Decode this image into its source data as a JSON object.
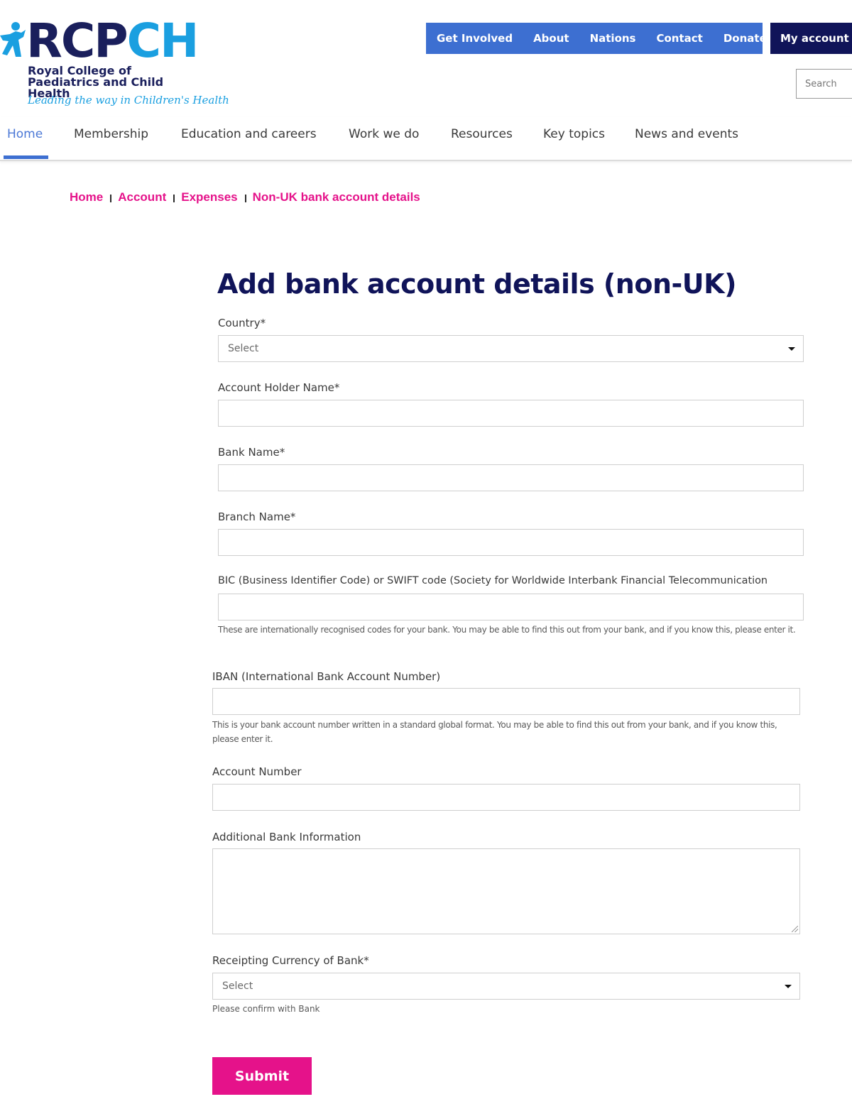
{
  "brand": {
    "name_part1": "RCP",
    "name_part2": "CH",
    "subtitle_line1": "Royal College of",
    "subtitle_line2": "Paediatrics and Child Health",
    "tagline": "Leading the way in Children's Health",
    "colors": {
      "navy": "#101459",
      "blue": "#3d6fd1",
      "pink": "#e5128a",
      "sky": "#1a9fe0"
    }
  },
  "utility_nav": [
    "Get Involved",
    "About",
    "Nations",
    "Contact",
    "Donate"
  ],
  "my_account": "My account",
  "search": {
    "placeholder": "Search"
  },
  "main_nav": {
    "items": [
      "Home",
      "Membership",
      "Education and careers",
      "Work we do",
      "Resources",
      "Key topics",
      "News and events"
    ],
    "active": "Home"
  },
  "breadcrumb": [
    "Home",
    "Account",
    "Expenses",
    "Non-UK bank account details"
  ],
  "form": {
    "title": "Add bank account details (non-UK)",
    "country": {
      "label": "Country*",
      "value": "Select"
    },
    "account_holder": {
      "label": "Account Holder Name*",
      "value": ""
    },
    "bank_name": {
      "label": "Bank Name*",
      "value": ""
    },
    "branch_name": {
      "label": "Branch Name*",
      "value": ""
    },
    "bic": {
      "label": "BIC (Business Identifier Code) or SWIFT code (Society for Worldwide Interbank Financial Telecommunication",
      "value": "",
      "hint": "These are internationally recognised codes for your bank. You may be able to find this out from your bank, and if you know this, please enter it."
    },
    "iban": {
      "label": "IBAN (International Bank Account Number)",
      "value": "",
      "hint": "This is your bank account number written in a standard global format. You may be able to find this out from your bank, and if you know this, please enter it."
    },
    "account_number": {
      "label": "Account Number",
      "value": ""
    },
    "additional_info": {
      "label": "Additional Bank Information",
      "value": ""
    },
    "currency": {
      "label": "Receipting Currency of Bank*",
      "value": "Select",
      "hint": "Please confirm with Bank"
    },
    "submit_label": "Submit"
  }
}
